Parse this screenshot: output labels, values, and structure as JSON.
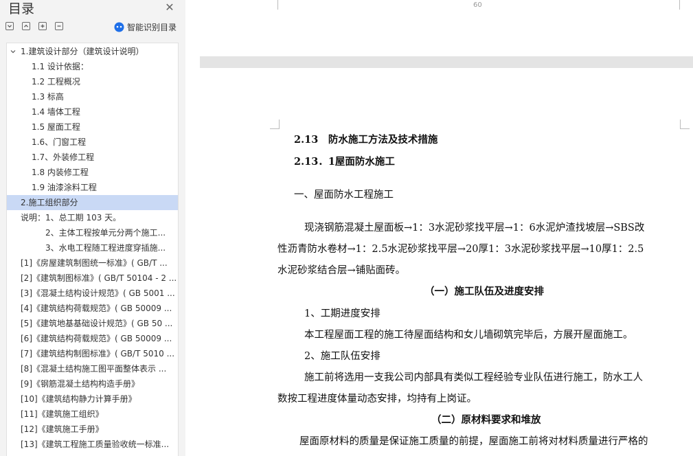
{
  "sidebar": {
    "title": "目录",
    "smart_toc_label": "智能识别目录",
    "toc": [
      {
        "label": "1.建筑设计部分（建筑设计说明）"
      },
      {
        "label": "1.1 设计依据："
      },
      {
        "label": "1.2 工程概况"
      },
      {
        "label": "1.3 标高"
      },
      {
        "label": "1.4 墙体工程"
      },
      {
        "label": "1.5 屋面工程"
      },
      {
        "label": "1.6、门窗工程"
      },
      {
        "label": "1.7、外装修工程"
      },
      {
        "label": "1.8 内装修工程"
      },
      {
        "label": "1.9 油漆涂料工程"
      },
      {
        "label": "2.施工组织部分"
      },
      {
        "label": "说明：1、总工期 103 天。"
      },
      {
        "label": "2、主体工程按单元分两个施工..."
      },
      {
        "label": "3、水电工程随工程进度穿插施..."
      },
      {
        "label": "[1]《房屋建筑制图统一标准》( GB/T ..."
      },
      {
        "label": "[2]《建筑制图标准》( GB/T 50104 - 2 ..."
      },
      {
        "label": "[3]《混凝土结构设计规范》( GB 5001 ..."
      },
      {
        "label": "[4]《建筑结构荷载规范》( GB 50009 ..."
      },
      {
        "label": "[5]《建筑地基基础设计规范》( GB 50 ..."
      },
      {
        "label": "[6]《建筑结构荷载规范》( GB 50009 ..."
      },
      {
        "label": "[7]《建筑结构制图标准》( GB/T 5010 ..."
      },
      {
        "label": "[8]《混凝土结构施工图平面整体表示 ..."
      },
      {
        "label": "[9]《钢筋混凝土结构构造手册》"
      },
      {
        "label": "[10]《建筑结构静力计算手册》"
      },
      {
        "label": "[11]《建筑施工组织》"
      },
      {
        "label": "[12]《建筑施工手册》"
      },
      {
        "label": "[13]《建筑工程施工质量验收统一标准..."
      }
    ]
  },
  "document": {
    "page_number": "60",
    "heading_1": "2.13　防水施工方法及技术措施",
    "heading_2": "2.13．1屋面防水施工",
    "section_1": "一、屋面防水工程施工",
    "para_1_line_1": "现浇钢筋混凝土屋面板→1：3水泥砂浆找平层→1：6水泥炉渣找坡层→SBS改",
    "para_1_line_2": "性沥青防水卷材→1：2.5水泥砂浆找平层→20厚1：3水泥砂浆找平层→10厚1：2.5",
    "para_1_line_3": "水泥砂浆结合层→铺贴面砖。",
    "sub_heading_1": "（一）施工队伍及进度安排",
    "item_1": "1、工期进度安排",
    "para_2": "本工程屋面工程的施工待屋面结构和女儿墙砌筑完毕后，方展开屋面施工。",
    "item_2": "2、施工队伍安排",
    "para_3_line_1": "施工前将选用一支我公司内部具有类似工程经验专业队伍进行施工，防水工人",
    "para_3_line_2": "数按工程进度体量动态安排，均持有上岗证。",
    "sub_heading_2": "（二）原材料要求和堆放",
    "para_4_line_1": "屋面原材料的质量是保证施工质量的前提，屋面施工前将对材料质量进行严格的"
  },
  "colors": {
    "sidebar_bg": "#f3f3f3",
    "selected_bg": "#c9d9f5",
    "canvas_bg": "#e4e4e4",
    "accent": "#1e6fe8"
  }
}
